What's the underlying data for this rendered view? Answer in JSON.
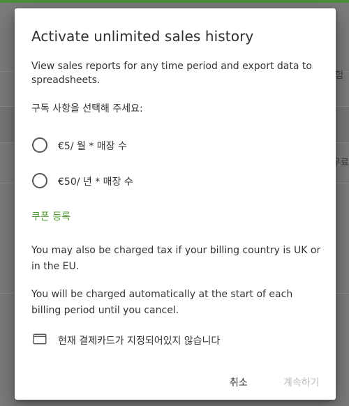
{
  "background": {
    "accent_color": "#4e8f3a",
    "edge_text_1": "험",
    "edge_text_2": "무료"
  },
  "dialog": {
    "title": "Activate unlimited sales history",
    "description": "View sales reports for any time period and export data to spreadsheets.",
    "choose_label": "구독 사항을 선택해 주세요:",
    "options": [
      {
        "label": "€5/ 월 * 매장 수",
        "selected": false
      },
      {
        "label": "€50/ 년 * 매장 수",
        "selected": false
      }
    ],
    "coupon_link": "쿠폰 등록",
    "coupon_color": "#4e9a2e",
    "tax_note": "You may also be charged tax if your billing country is UK or in the EU.",
    "billing_note": "You will be charged automatically at the start of each billing period until you cancel.",
    "card_icon": "credit-card-icon",
    "card_status": "현재 결제카드가 지정되어있지 않습니다",
    "cancel_label": "취소",
    "continue_label": "계속하기",
    "continue_enabled": false
  }
}
